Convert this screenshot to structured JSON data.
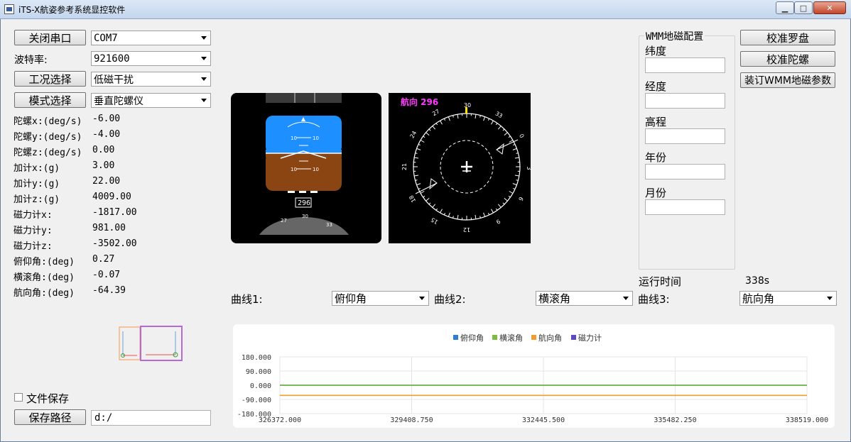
{
  "window": {
    "title": "iTS-X航姿参考系统显控软件"
  },
  "controls": {
    "close_port_label": "关闭串口",
    "port_value": "COM7",
    "baud_label": "波特率:",
    "baud_value": "921600",
    "condition_label": "工况选择",
    "condition_value": "低磁干扰",
    "mode_label": "模式选择",
    "mode_value": "垂直陀螺仪"
  },
  "readouts": [
    {
      "label": "陀螺x:(deg/s)",
      "value": "-6.00"
    },
    {
      "label": "陀螺y:(deg/s)",
      "value": "-4.00"
    },
    {
      "label": "陀螺z:(deg/s)",
      "value": "0.00"
    },
    {
      "label": "加计x:(g)",
      "value": "3.00"
    },
    {
      "label": "加计y:(g)",
      "value": "22.00"
    },
    {
      "label": "加计z:(g)",
      "value": "4009.00"
    },
    {
      "label": "磁力计x:",
      "value": "-1817.00"
    },
    {
      "label": "磁力计y:",
      "value": "981.00"
    },
    {
      "label": "磁力计z:",
      "value": "-3502.00"
    },
    {
      "label": "俯仰角:(deg)",
      "value": "0.27"
    },
    {
      "label": "横滚角:(deg)",
      "value": "-0.07"
    },
    {
      "label": "航向角:(deg)",
      "value": "-64.39"
    }
  ],
  "file": {
    "save_checkbox_label": "文件保存",
    "save_checked": false,
    "save_path_label": "保存路径",
    "save_path_value": "d:/"
  },
  "attitude": {
    "pitch_marks": [
      "10",
      "10",
      "10",
      "10"
    ],
    "heading_box": "296",
    "heading_scale": [
      "27",
      "30",
      "33"
    ]
  },
  "compass": {
    "heading_label": "航向 296",
    "ticks": [
      "30",
      "33",
      "0",
      "3",
      "6",
      "9",
      "12",
      "15",
      "18",
      "21",
      "24",
      "27"
    ]
  },
  "wmm": {
    "group_title": "WMM地磁配置",
    "latitude_label": "纬度",
    "longitude_label": "经度",
    "altitude_label": "高程",
    "year_label": "年份",
    "month_label": "月份"
  },
  "side_buttons": {
    "calibrate_compass": "校准罗盘",
    "calibrate_gyro": "校准陀螺",
    "load_wmm": "装订WMM地磁参数"
  },
  "runtime": {
    "label": "运行时间",
    "value": "338s"
  },
  "curves": {
    "curve1_label": "曲线1:",
    "curve1_value": "俯仰角",
    "curve2_label": "曲线2:",
    "curve2_value": "横滚角",
    "curve3_label": "曲线3:",
    "curve3_value": "航向角"
  },
  "chart_data": {
    "type": "line",
    "title": "",
    "xlabel": "",
    "ylabel": "",
    "legend_position": "top-center",
    "ylim": [
      -180,
      180
    ],
    "xlim": [
      326372,
      338519
    ],
    "y_ticks": [
      "180.000",
      "90.000",
      "0.000",
      "-90.000",
      "-180.000"
    ],
    "x_ticks": [
      "326372.000",
      "329408.750",
      "332445.500",
      "335482.250",
      "338519.000"
    ],
    "series": [
      {
        "name": "俯仰角",
        "color": "#2f7fd0",
        "x": [
          326372,
          338519
        ],
        "y": [
          0.27,
          0.27
        ]
      },
      {
        "name": "横滚角",
        "color": "#7dbb42",
        "x": [
          326372,
          338519
        ],
        "y": [
          -0.07,
          -0.07
        ]
      },
      {
        "name": "航向角",
        "color": "#f39c2c",
        "x": [
          326372,
          338519
        ],
        "y": [
          -64.39,
          -64.39
        ]
      },
      {
        "name": "磁力计",
        "color": "#5b4ac4",
        "x": [],
        "y": []
      }
    ]
  }
}
